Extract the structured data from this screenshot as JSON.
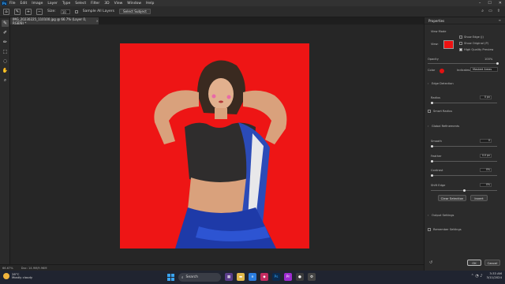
{
  "app": {
    "logo": "Ps",
    "menus": [
      "File",
      "Edit",
      "Image",
      "Layer",
      "Type",
      "Select",
      "Filter",
      "3D",
      "View",
      "Window",
      "Help"
    ]
  },
  "options_bar": {
    "size_label": "Size:",
    "size_value": "10",
    "sample_all_layers": "Sample All Layers",
    "select_subject": "Select Subject"
  },
  "document": {
    "tab_title": "IMG_20230225_110100.jpg @ 66.7% (Layer 0, RGB/8) *",
    "zoom": "66.67%",
    "doc_info": "Doc: 14.9M/9.96M"
  },
  "properties": {
    "title": "Properties",
    "view_mode_label": "View Mode",
    "view_label": "View:",
    "show_edge": "Show Edge (J)",
    "show_original": "Show Original (P)",
    "high_quality_preview": "High Quality Preview",
    "opacity_label": "Opacity",
    "opacity_value": "100%",
    "color_label": "Color",
    "indicates_label": "Indicates:",
    "indicates_value": "Masked Areas",
    "edge_detection_label": "Edge Detection",
    "radius_label": "Radius",
    "radius_value": "0 px",
    "smart_radius": "Smart Radius",
    "global_refinements_label": "Global Refinements",
    "smooth_label": "Smooth",
    "smooth_value": "0",
    "feather_label": "Feather",
    "feather_value": "0.0 px",
    "contrast_label": "Contrast",
    "contrast_value": "0%",
    "shift_edge_label": "Shift Edge",
    "shift_edge_value": "0%",
    "clear_selection": "Clear Selection",
    "invert": "Invert",
    "output_settings_label": "Output Settings",
    "remember_settings": "Remember Settings",
    "ok": "OK",
    "cancel": "Cancel"
  },
  "taskbar": {
    "temperature": "28°C",
    "weather": "Mostly cloudy",
    "search_placeholder": "Search",
    "time": "3:33 AM",
    "date": "3/11/2024"
  },
  "colors": {
    "accent": "#31a8ff",
    "mask_color": "#e11212",
    "background": "#ee1515"
  }
}
